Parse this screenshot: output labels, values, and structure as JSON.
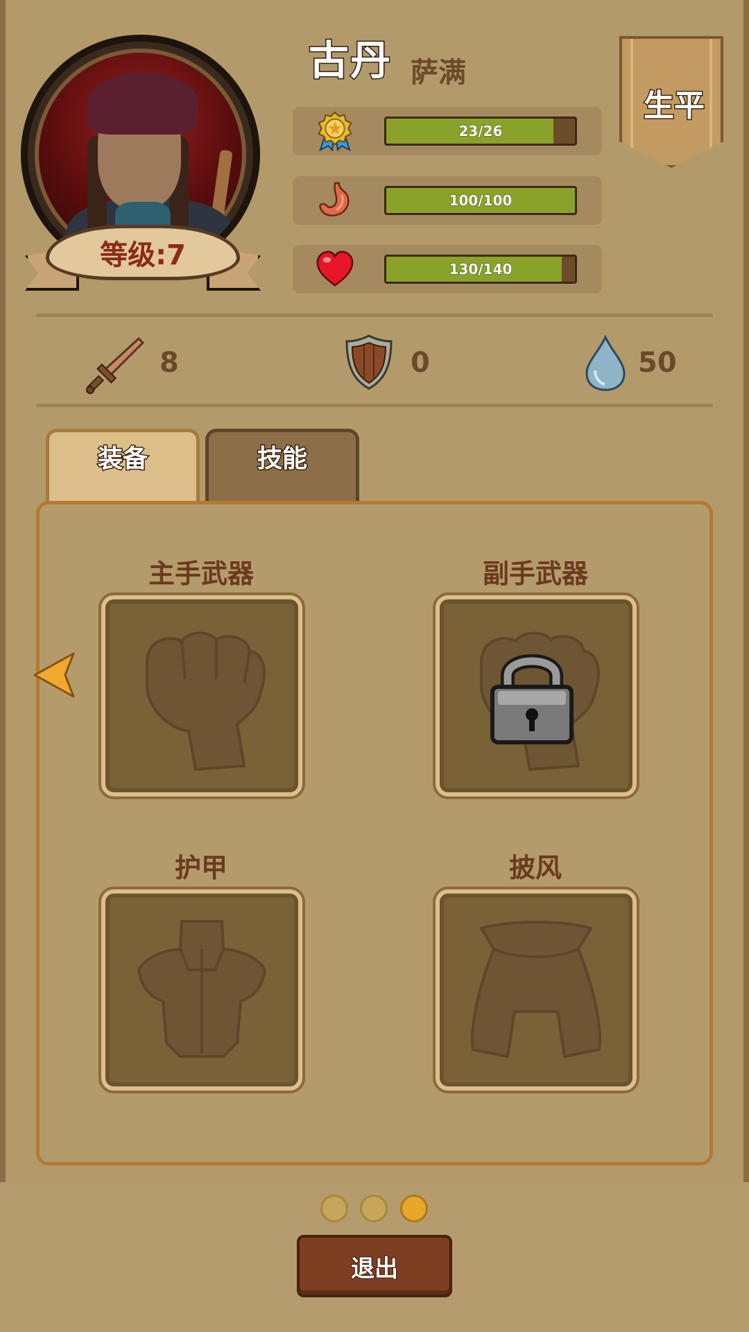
{
  "hero": {
    "name": "古丹",
    "class": "萨满",
    "level_label": "等级:7"
  },
  "bio_button": "生平",
  "stats": [
    {
      "icon": "medal-icon",
      "text": "23/26",
      "fill": 0.885
    },
    {
      "icon": "stomach-icon",
      "text": "100/100",
      "fill": 1.0
    },
    {
      "icon": "heart-icon",
      "text": "130/140",
      "fill": 0.929
    }
  ],
  "attributes": {
    "attack": "8",
    "defense": "0",
    "mana": "50"
  },
  "tabs": {
    "equipment": "装备",
    "skills": "技能"
  },
  "slots": {
    "main_hand": "主手武器",
    "off_hand": "副手武器",
    "armor": "护甲",
    "cloak": "披风"
  },
  "pager": {
    "count": 3,
    "active": 3
  },
  "exit_label": "退出",
  "colors": {
    "background": "#b39a6b",
    "bar_fill": "#8aa22a",
    "exit_button": "#7d3e22",
    "active_dot": "#e8a62a"
  }
}
